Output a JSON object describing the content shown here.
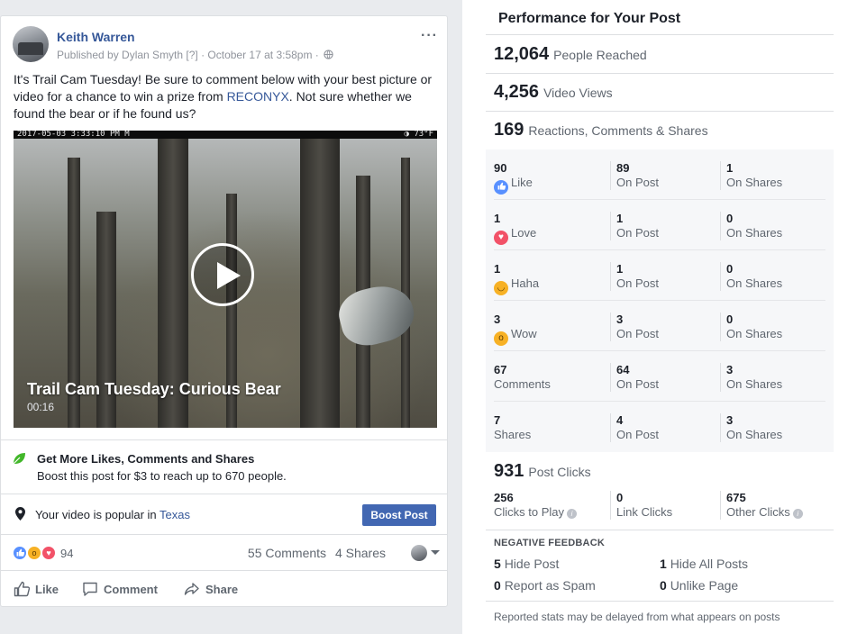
{
  "post": {
    "author": "Keith Warren",
    "meta": "Published by Dylan Smyth [?] · October 17 at 3:58pm ·",
    "more": "···",
    "text_before_link": "It's Trail Cam Tuesday! Be sure to comment below with your best picture or video for a chance to win a prize from ",
    "text_link": "RECONYX",
    "text_after_link": ". Not sure whether we found the bear or if he found us?",
    "video": {
      "cam_stamp_left": "2017-05-03  3:33:10 PM  M",
      "cam_stamp_right": "◑  73°F",
      "title": "Trail Cam Tuesday: Curious Bear",
      "duration": "00:16"
    },
    "promo": {
      "title": "Get More Likes, Comments and Shares",
      "subtitle": "Boost this post for $3 to reach up to 670 people."
    },
    "popular": {
      "text": "Your video is popular in ",
      "location": "Texas",
      "boost_label": "Boost Post"
    },
    "reactions": {
      "count": "94",
      "comments": "55 Comments",
      "shares": "4 Shares"
    },
    "actions": {
      "like": "Like",
      "comment": "Comment",
      "share": "Share"
    }
  },
  "performance": {
    "title": "Performance for Your Post",
    "reached": {
      "value": "12,064",
      "label": "People Reached"
    },
    "views": {
      "value": "4,256",
      "label": "Video Views"
    },
    "engagement": {
      "value": "169",
      "label": "Reactions, Comments & Shares"
    },
    "rows": [
      {
        "total": "90",
        "label": "Like",
        "on_post": "89",
        "on_post_label": "On Post",
        "on_shares": "1",
        "on_shares_label": "On Shares"
      },
      {
        "total": "1",
        "label": "Love",
        "on_post": "1",
        "on_post_label": "On Post",
        "on_shares": "0",
        "on_shares_label": "On Shares"
      },
      {
        "total": "1",
        "label": "Haha",
        "on_post": "1",
        "on_post_label": "On Post",
        "on_shares": "0",
        "on_shares_label": "On Shares"
      },
      {
        "total": "3",
        "label": "Wow",
        "on_post": "3",
        "on_post_label": "On Post",
        "on_shares": "0",
        "on_shares_label": "On Shares"
      },
      {
        "total": "67",
        "label": "Comments",
        "on_post": "64",
        "on_post_label": "On Post",
        "on_shares": "3",
        "on_shares_label": "On Shares"
      },
      {
        "total": "7",
        "label": "Shares",
        "on_post": "4",
        "on_post_label": "On Post",
        "on_shares": "3",
        "on_shares_label": "On Shares"
      }
    ],
    "clicks": {
      "value": "931",
      "label": "Post Clicks"
    },
    "click_breakdown": [
      {
        "value": "256",
        "label": "Clicks to Play"
      },
      {
        "value": "0",
        "label": "Link Clicks"
      },
      {
        "value": "675",
        "label": "Other Clicks"
      }
    ],
    "negative": {
      "title": "NEGATIVE FEEDBACK",
      "hide_post": {
        "value": "5",
        "label": "Hide Post"
      },
      "hide_all": {
        "value": "1",
        "label": "Hide All Posts"
      },
      "spam": {
        "value": "0",
        "label": "Report as Spam"
      },
      "unlike": {
        "value": "0",
        "label": "Unlike Page"
      }
    },
    "footer": "Reported stats may be delayed from what appears on posts"
  },
  "colors": {
    "link": "#365899",
    "button": "#4267b2",
    "like": "#5890ff",
    "love": "#f25268",
    "haha": "#f7b125",
    "wow": "#f7b125"
  }
}
